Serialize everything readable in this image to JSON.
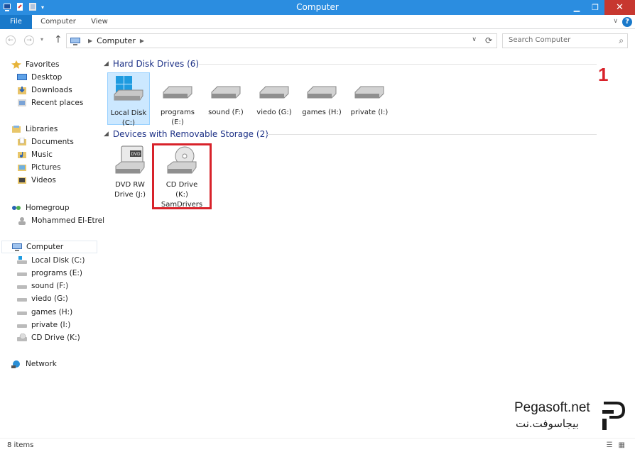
{
  "window": {
    "title": "Computer"
  },
  "ribbon": {
    "tabs": [
      "File",
      "Computer",
      "View"
    ],
    "help": "?"
  },
  "address": {
    "path": "Computer",
    "search_placeholder": "Search Computer"
  },
  "nav": {
    "favorites": {
      "header": "Favorites",
      "items": [
        "Desktop",
        "Downloads",
        "Recent places"
      ]
    },
    "libraries": {
      "header": "Libraries",
      "items": [
        "Documents",
        "Music",
        "Pictures",
        "Videos"
      ]
    },
    "homegroup": {
      "header": "Homegroup",
      "items": [
        "Mohammed El-Etrel"
      ]
    },
    "computer": {
      "header": "Computer",
      "items": [
        "Local Disk (C:)",
        "programs (E:)",
        "sound (F:)",
        "viedo (G:)",
        "games (H:)",
        "private (I:)",
        "CD Drive (K:)"
      ]
    },
    "network": {
      "header": "Network"
    }
  },
  "content": {
    "hdd_group": "Hard Disk Drives (6)",
    "drives": [
      {
        "line1": "Local Disk",
        "line2": "(C:)",
        "icon": "system-drive-icon"
      },
      {
        "line1": "programs",
        "line2": "(E:)",
        "icon": "hard-drive-icon"
      },
      {
        "line1": "sound (F:)",
        "line2": "",
        "icon": "hard-drive-icon"
      },
      {
        "line1": "viedo (G:)",
        "line2": "",
        "icon": "hard-drive-icon"
      },
      {
        "line1": "games (H:)",
        "line2": "",
        "icon": "hard-drive-icon"
      },
      {
        "line1": "private (I:)",
        "line2": "",
        "icon": "hard-drive-icon"
      }
    ],
    "removable_group": "Devices with Removable Storage (2)",
    "removable": [
      {
        "line1": "DVD RW",
        "line2": "Drive (J:)",
        "line3": "",
        "icon": "dvd-drive-icon"
      },
      {
        "line1": "CD Drive",
        "line2": "(K:)",
        "line3": "SamDrivers",
        "icon": "cd-drive-icon"
      }
    ],
    "step_number": "1"
  },
  "watermark": {
    "latin": "Pegasoft.net",
    "arabic": "بيجاسوفت.نت"
  },
  "status": {
    "count": "8 items"
  },
  "colors": {
    "titlebar": "#2b8de0",
    "file_tab": "#1979ca",
    "highlight": "#d8222a",
    "group_header": "#1e3287"
  }
}
